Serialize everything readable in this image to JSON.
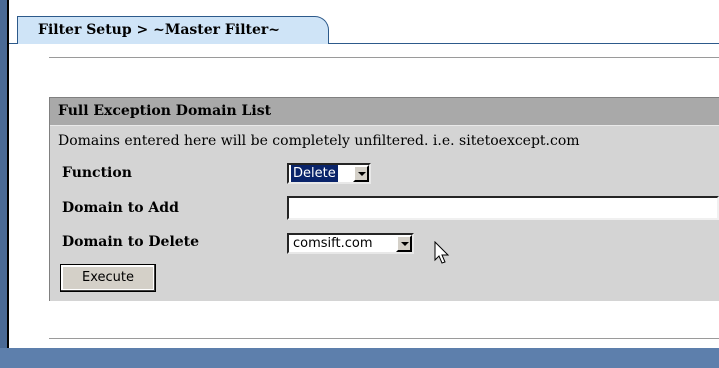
{
  "tab": {
    "title": "Filter Setup > ~Master Filter~"
  },
  "panel": {
    "header": "Full Exception Domain List",
    "description": "Domains entered here will be completely unfiltered. i.e. sitetoexcept.com",
    "function_label": "Function",
    "function_value": "Delete",
    "domain_add_label": "Domain to Add",
    "domain_add_value": "",
    "domain_delete_label": "Domain to Delete",
    "domain_delete_value": "comsift.com",
    "execute_label": "Execute"
  },
  "colors": {
    "frame": "#4a6a96",
    "tab_bg": "#cfe4f7",
    "panel_bg": "#d4d4d4",
    "header_bg": "#a9a9a9",
    "selection": "#0a246a"
  },
  "icons": {
    "cursor": "arrow-cursor-icon"
  }
}
